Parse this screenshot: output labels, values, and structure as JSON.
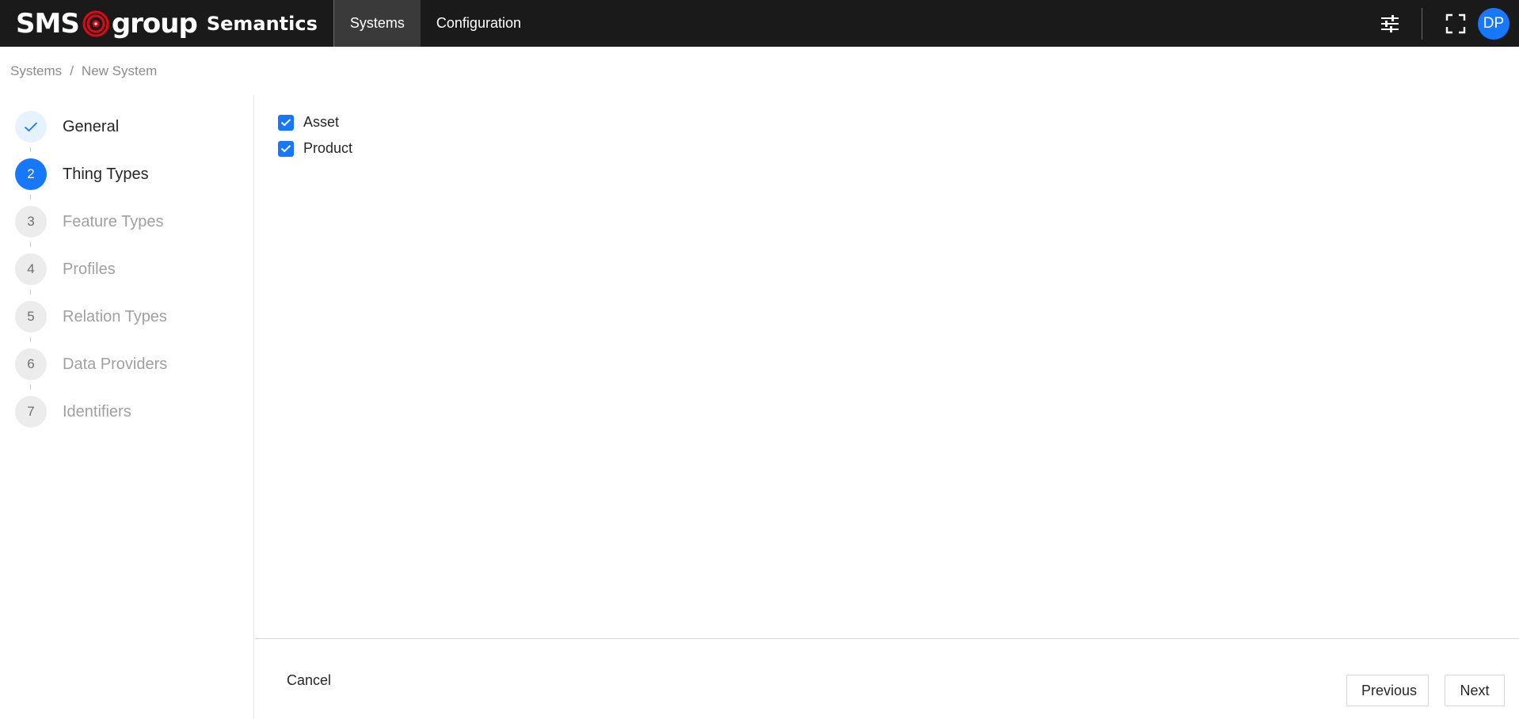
{
  "header": {
    "brand_sms": "SMS",
    "brand_group": "group",
    "brand_product": "Semantics",
    "nav": [
      {
        "label": "Systems",
        "active": true
      },
      {
        "label": "Configuration",
        "active": false
      }
    ],
    "icons": [
      "settings-sliders-icon",
      "fullscreen-icon"
    ],
    "avatar_initials": "DP"
  },
  "breadcrumb": {
    "items": [
      "Systems",
      "New System"
    ],
    "separator": "/"
  },
  "steps": [
    {
      "number": "",
      "label": "General",
      "state": "done",
      "icon": "check-icon"
    },
    {
      "number": "2",
      "label": "Thing Types",
      "state": "current"
    },
    {
      "number": "3",
      "label": "Feature Types",
      "state": "pending"
    },
    {
      "number": "4",
      "label": "Profiles",
      "state": "pending"
    },
    {
      "number": "5",
      "label": "Relation Types",
      "state": "pending"
    },
    {
      "number": "6",
      "label": "Data Providers",
      "state": "pending"
    },
    {
      "number": "7",
      "label": "Identifiers",
      "state": "pending"
    }
  ],
  "thing_types": [
    {
      "label": "Asset",
      "checked": true
    },
    {
      "label": "Product",
      "checked": true
    }
  ],
  "footer": {
    "cancel_label": "Cancel",
    "previous_label": "Previous",
    "next_label": "Next"
  },
  "colors": {
    "topbar_bg": "#1a1a1a",
    "primary": "#1677ff",
    "logo_red": "#e30613"
  }
}
